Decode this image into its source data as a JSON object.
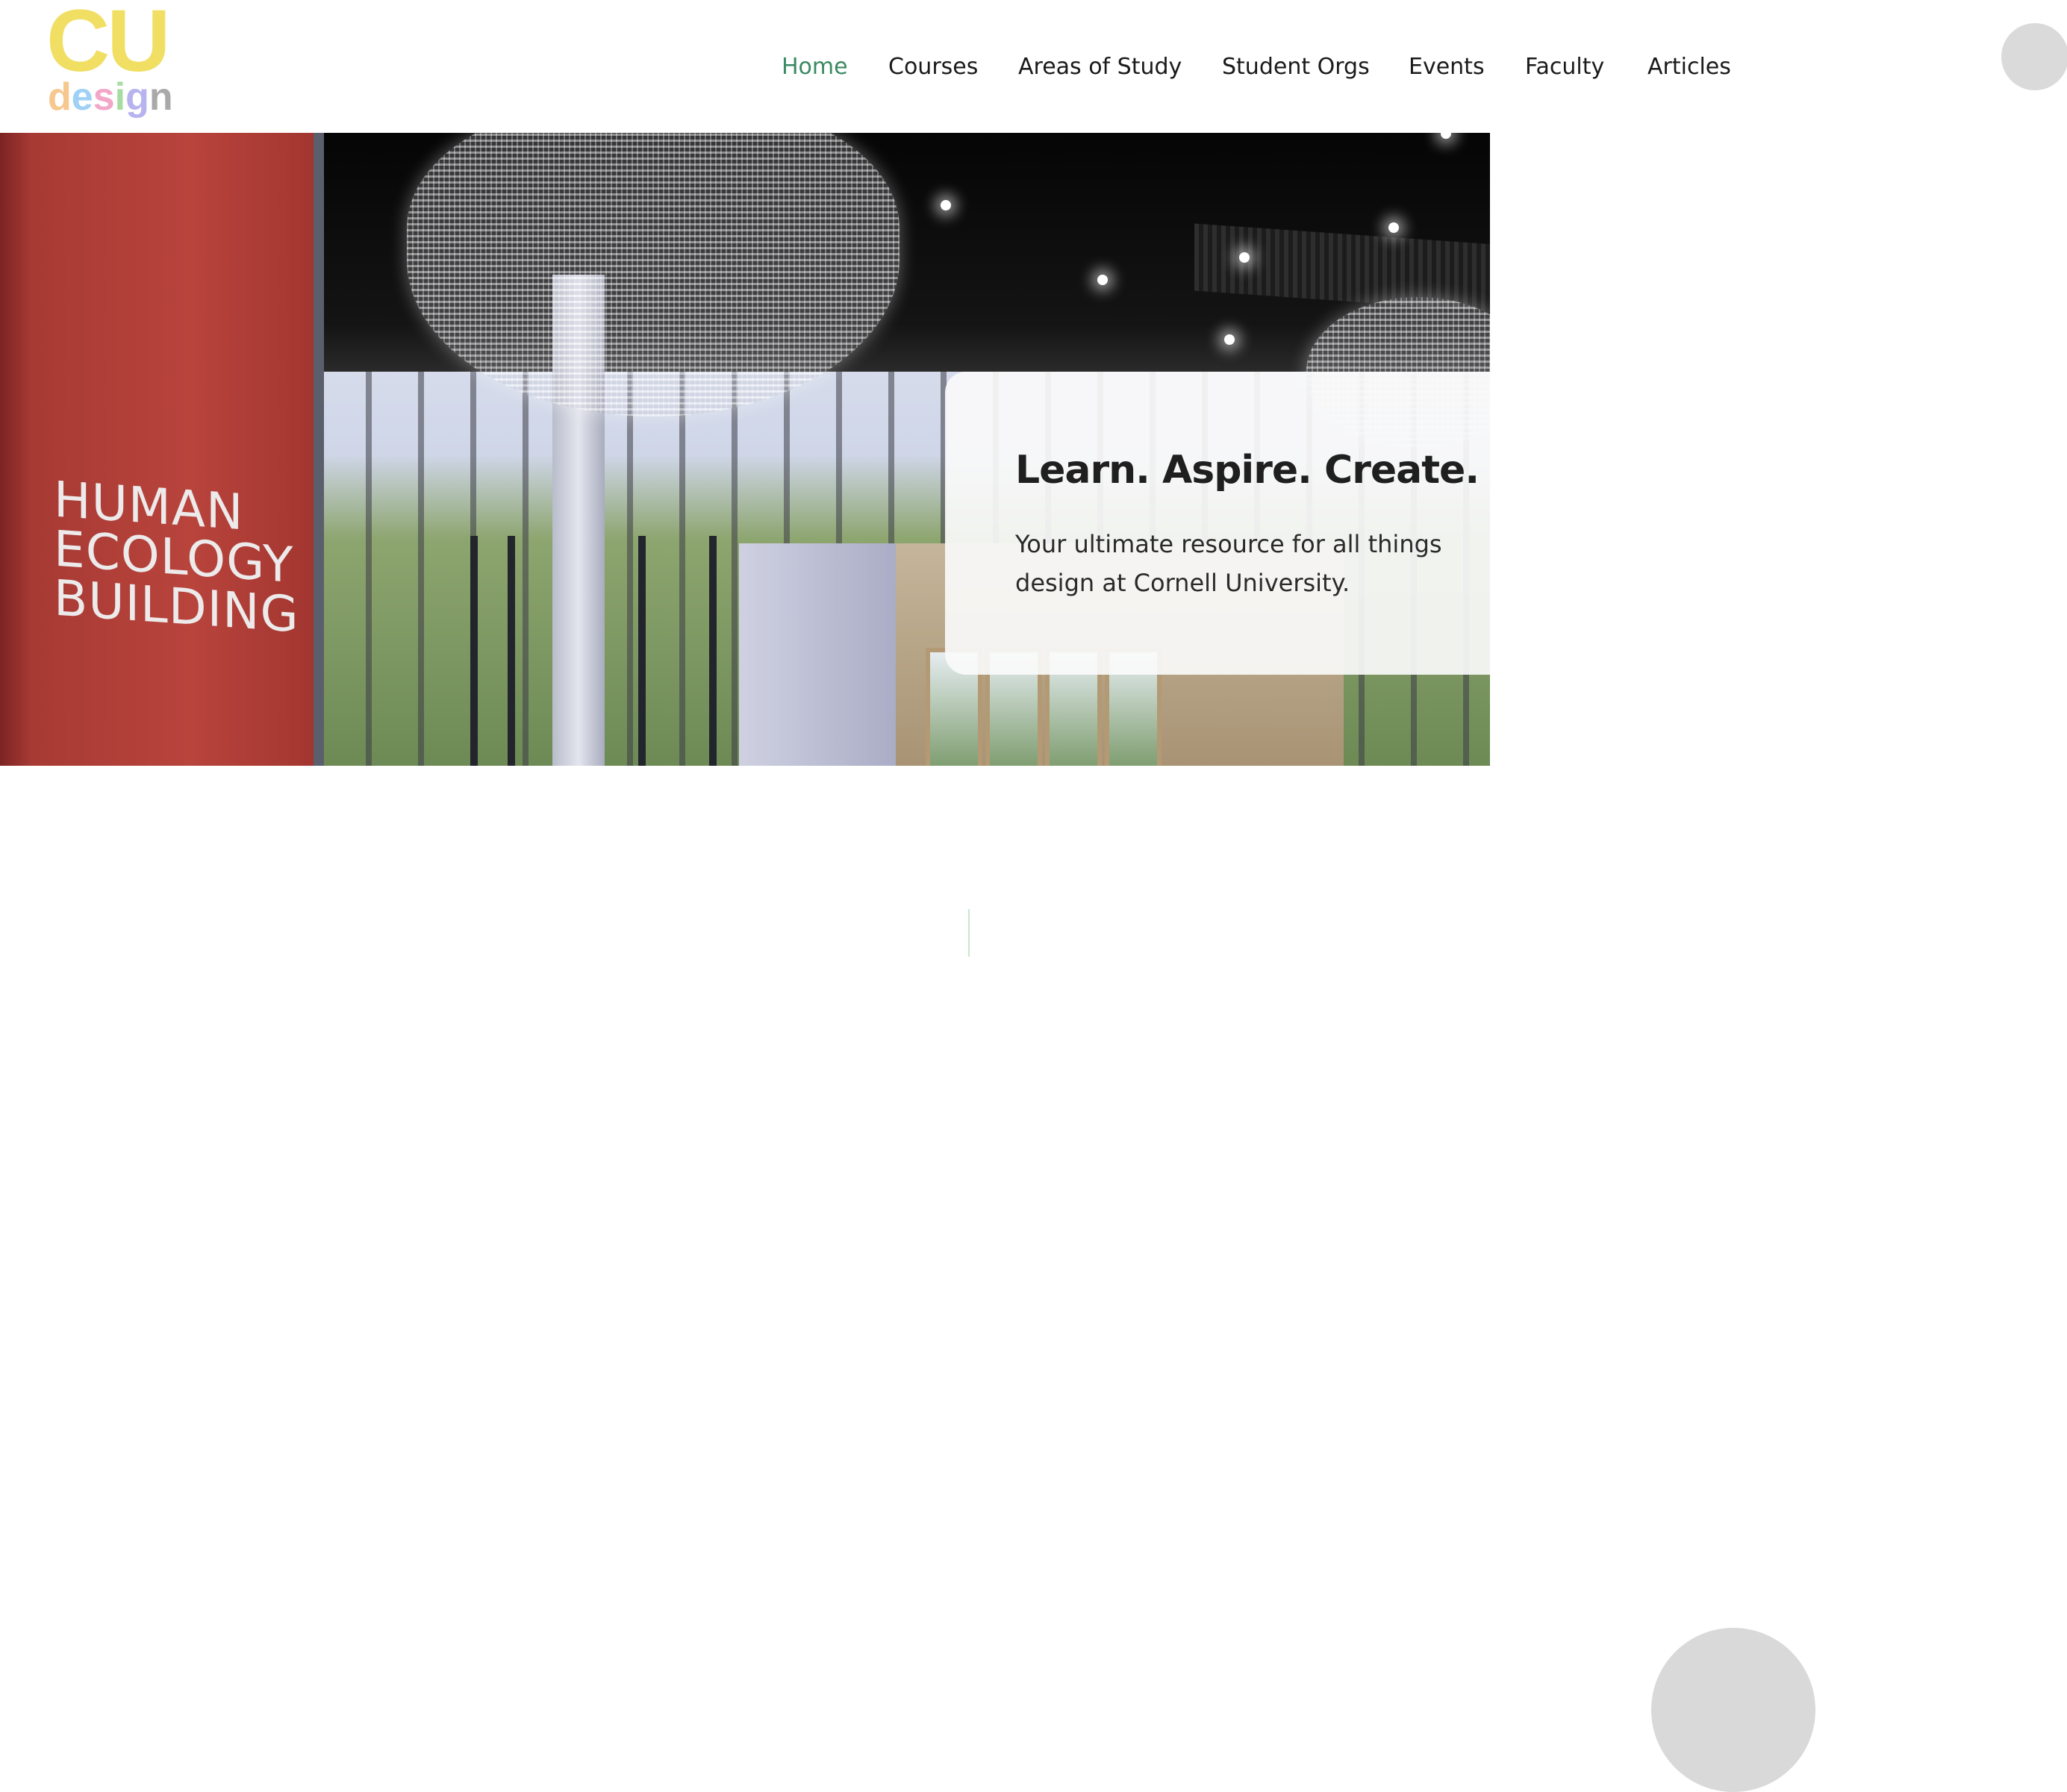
{
  "logo": {
    "cu": "CU",
    "design_letters": [
      {
        "char": "d",
        "color": "#f6c88d"
      },
      {
        "char": "e",
        "color": "#9ed1f5"
      },
      {
        "char": "s",
        "color": "#f2a7c9"
      },
      {
        "char": "i",
        "color": "#a7dca2"
      },
      {
        "char": "g",
        "color": "#b7b3ee"
      },
      {
        "char": "n",
        "color": "#a9a9a9"
      }
    ],
    "cu_color": "#f1df63"
  },
  "nav": {
    "items": [
      {
        "label": "Home",
        "active": true
      },
      {
        "label": "Courses",
        "active": false
      },
      {
        "label": "Areas of Study",
        "active": false
      },
      {
        "label": "Student Orgs",
        "active": false
      },
      {
        "label": "Events",
        "active": false
      },
      {
        "label": "Faculty",
        "active": false
      },
      {
        "label": "Articles",
        "active": false
      }
    ],
    "active_color": "#3a8a63",
    "text_color": "#1a1a1a"
  },
  "hero": {
    "sign_lines": [
      "HUMAN",
      "ECOLOGY",
      "BUILDING"
    ],
    "title": "Learn. Aspire. Create.",
    "subtitle": "Your ultimate resource for all things design at Cornell University."
  },
  "icons": {
    "profile_top": "user-avatar",
    "profile_bottom": "user-avatar"
  }
}
